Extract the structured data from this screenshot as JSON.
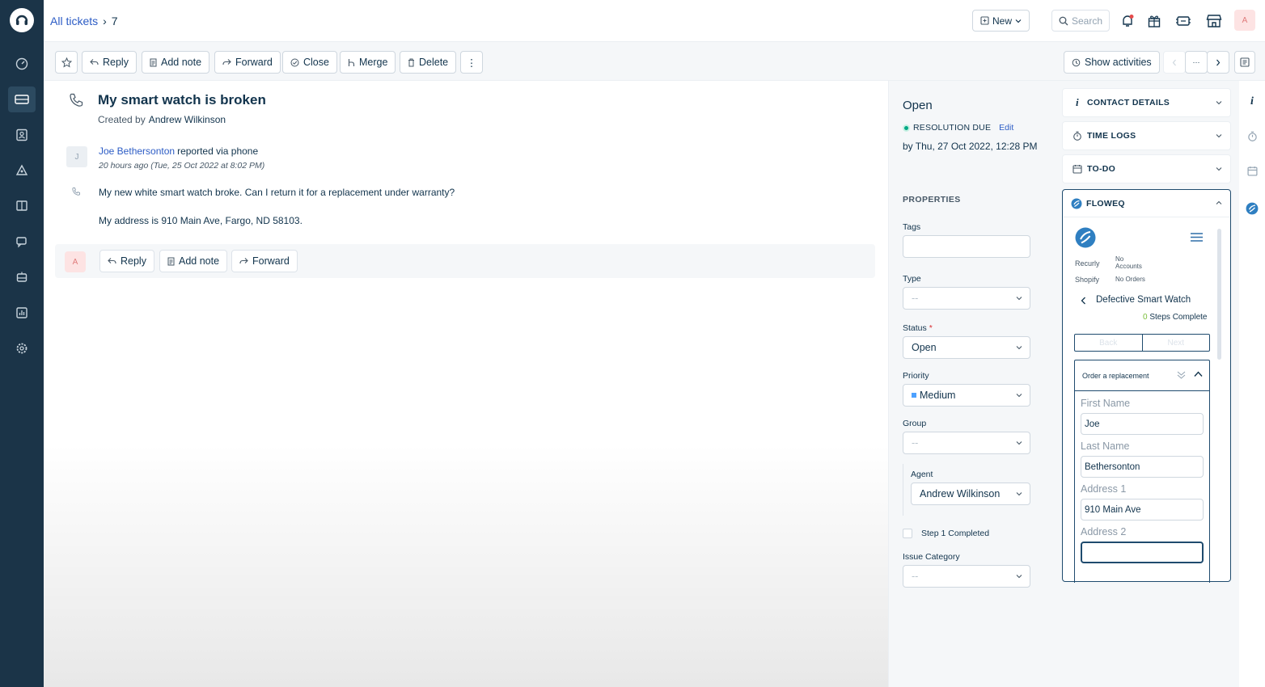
{
  "breadcrumb": {
    "all_tickets": "All tickets",
    "sep": "›",
    "ticket_number": "7"
  },
  "topbar": {
    "new_label": "New",
    "search_placeholder": "Search",
    "avatar_initial": "A"
  },
  "toolbar": {
    "reply": "Reply",
    "add_note": "Add note",
    "forward": "Forward",
    "close": "Close",
    "merge": "Merge",
    "delete": "Delete",
    "more": "⋮",
    "show_activities": "Show activities",
    "ellipsis": "···"
  },
  "ticket": {
    "title": "My smart watch is broken",
    "created_by_label": "Created by",
    "created_by": "Andrew Wilkinson",
    "requester_initial": "J",
    "requester": "Joe Bethersonton",
    "channel_text": "reported via phone",
    "timestamp": "20 hours ago (Tue, 25 Oct 2022 at 8:02 PM)",
    "message_line1": "My new white smart watch broke. Can I return it for a replacement under warranty?",
    "message_line2": "My address is 910 Main Ave, Fargo, ND 58103."
  },
  "reply_bar": {
    "avatar_initial": "A",
    "reply": "Reply",
    "add_note": "Add note",
    "forward": "Forward"
  },
  "properties": {
    "status_title": "Open",
    "resolution_due_label": "RESOLUTION DUE",
    "edit_label": "Edit",
    "due_date": "by Thu, 27 Oct 2022, 12:28 PM",
    "section_title": "PROPERTIES",
    "tags_label": "Tags",
    "type_label": "Type",
    "type_value": "--",
    "status_label": "Status",
    "status_required": "*",
    "status_value": "Open",
    "priority_label": "Priority",
    "priority_value": "Medium",
    "priority_color": "#4da1ff",
    "group_label": "Group",
    "group_value": "--",
    "agent_label": "Agent",
    "agent_value": "Andrew Wilkinson",
    "step1_label": "Step 1 Completed",
    "issue_category_label": "Issue Category",
    "issue_category_value": "--"
  },
  "apps": {
    "contact_details": "CONTACT DETAILS",
    "time_logs": "TIME LOGS",
    "todo": "TO-DO",
    "floweq": {
      "header": "FLOWEQ",
      "recurly_label": "Recurly",
      "recurly_value_1": "No",
      "recurly_value_2": "Accounts",
      "shopify_label": "Shopify",
      "shopify_value": "No Orders",
      "flow_title": "Defective Smart Watch",
      "steps_count": "0",
      "steps_text": "Steps Complete",
      "back": "Back",
      "next": "Next",
      "card_title": "Order a replacement",
      "first_name_label": "First Name",
      "first_name_value": "Joe",
      "last_name_label": "Last Name",
      "last_name_value": "Bethersonton",
      "address1_label": "Address 1",
      "address1_value": "910 Main Ave",
      "address2_label": "Address 2",
      "address2_value": ""
    }
  },
  "colors": {
    "sidebar": "#1b3448",
    "link": "#2c5cc5",
    "brand_dark": "#1f4b6e",
    "success": "#00a886"
  }
}
